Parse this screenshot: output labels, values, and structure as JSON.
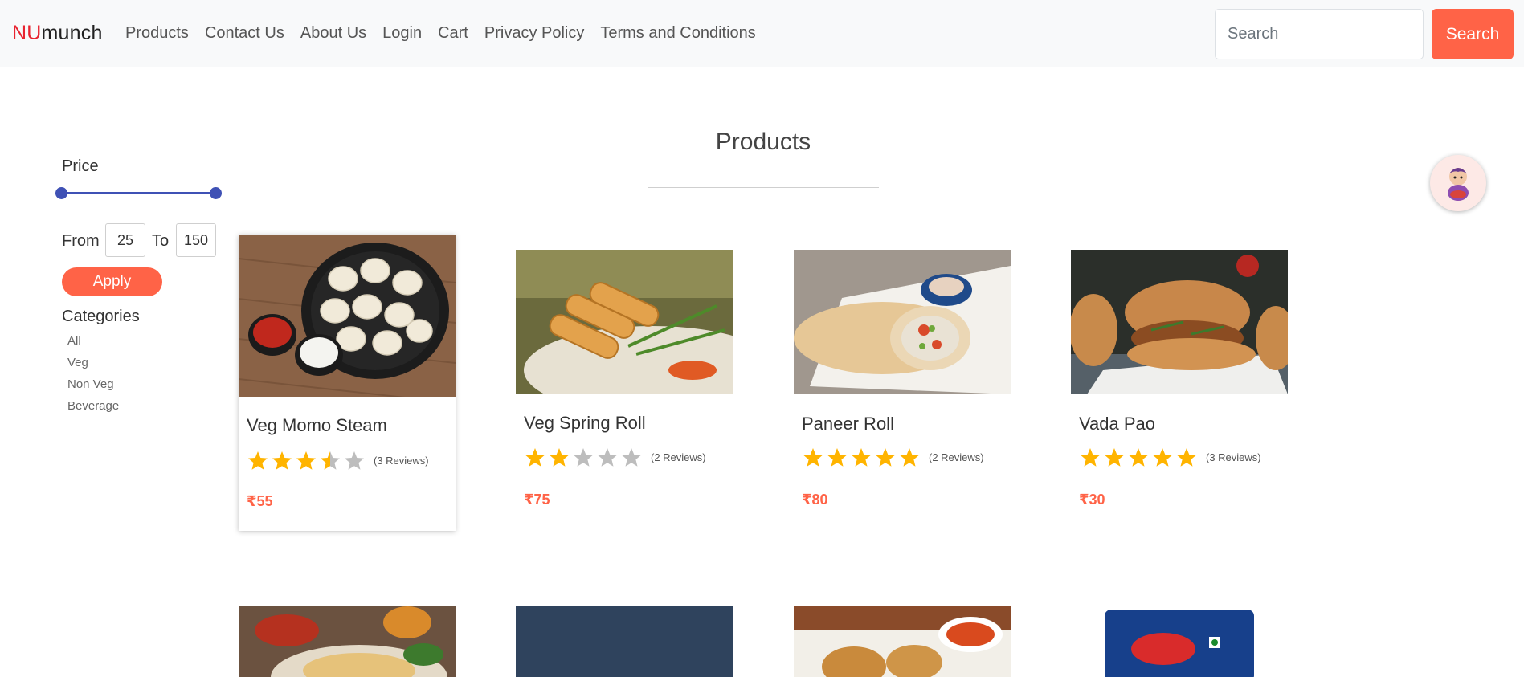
{
  "brand": {
    "prefix": "NU",
    "suffix": "munch"
  },
  "nav": {
    "links": [
      "Products",
      "Contact Us",
      "About Us",
      "Login",
      "Cart",
      "Privacy Policy",
      "Terms and Conditions"
    ],
    "search_placeholder": "Search",
    "search_button": "Search"
  },
  "filters": {
    "price_title": "Price",
    "price_range": {
      "min": 25,
      "max": 150
    },
    "from_label": "From",
    "to_label": "To",
    "from_value": "25",
    "to_value": "150",
    "apply_label": "Apply",
    "categories_title": "Categories",
    "categories": [
      "All",
      "Veg",
      "Non Veg",
      "Beverage"
    ]
  },
  "main": {
    "heading": "Products",
    "products": [
      {
        "name": "Veg Momo Steam",
        "rating": 3.5,
        "reviews": "(3 Reviews)",
        "price": "₹55"
      },
      {
        "name": "Veg Spring Roll",
        "rating": 2,
        "reviews": "(2 Reviews)",
        "price": "₹75"
      },
      {
        "name": "Paneer Roll",
        "rating": 5,
        "reviews": "(2 Reviews)",
        "price": "₹80"
      },
      {
        "name": "Vada Pao",
        "rating": 5,
        "reviews": "(3 Reviews)",
        "price": "₹30"
      }
    ]
  },
  "colors": {
    "accent": "#ff6347",
    "brand_red": "#e8232f",
    "star_on": "#ffb400",
    "star_off": "#bdbdbd",
    "slider": "#3f51b5"
  }
}
